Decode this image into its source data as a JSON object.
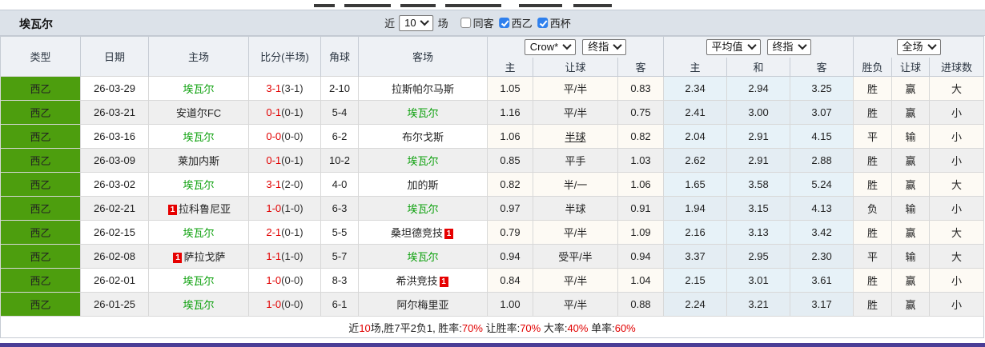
{
  "top_bar": {
    "team_name": "埃瓦尔",
    "recent": {
      "prefix": "近",
      "value": "10",
      "suffix": "场"
    },
    "filters": [
      {
        "label": "同客",
        "checked": false
      },
      {
        "label": "西乙",
        "checked": true
      },
      {
        "label": "西杯",
        "checked": true
      }
    ]
  },
  "controls": {
    "book_select": "Crow*",
    "book_time_select": "终指",
    "avg_select": "平均值",
    "avg_time_select": "终指",
    "scope_select": "全场"
  },
  "columns": {
    "type": "类型",
    "date": "日期",
    "home": "主场",
    "score": "比分(半场)",
    "corner": "角球",
    "away": "客场",
    "crow_home": "主",
    "crow_handicap": "让球",
    "crow_away": "客",
    "avg_home": "主",
    "avg_draw": "和",
    "avg_away": "客",
    "result_wdl": "胜负",
    "result_handicap": "让球",
    "result_goals": "进球数"
  },
  "accent_colors": {
    "league_green": "#4d9e0e",
    "self_team_green": "#0ca00c",
    "red": "#e10000",
    "blue": "#1414d6",
    "win_draw_green": "#009933",
    "avg_col_blue": "#e7f2f8",
    "bottom_bar_purple": "#4a3d96",
    "checkbox_blue": "#2f80ed"
  },
  "rows": [
    {
      "league": "西乙",
      "date": "26-03-29",
      "home": {
        "name": "埃瓦尔",
        "self": true,
        "badge": null,
        "badge_pos": null
      },
      "score": "3-1",
      "half": "(3-1)",
      "corner": "2-10",
      "away": {
        "name": "拉斯帕尔马斯",
        "self": false,
        "badge": null,
        "badge_pos": null
      },
      "odds": [
        "1.05",
        "平/半",
        "0.83"
      ],
      "handicap_hot": false,
      "avg": [
        "2.34",
        "2.94",
        "3.25"
      ],
      "results": [
        {
          "t": "胜",
          "c": "r"
        },
        {
          "t": "赢",
          "c": "r"
        },
        {
          "t": "大",
          "c": "r"
        }
      ]
    },
    {
      "league": "西乙",
      "date": "26-03-21",
      "home": {
        "name": "安道尔FC",
        "self": false,
        "badge": null,
        "badge_pos": null
      },
      "score": "0-1",
      "half": "(0-1)",
      "corner": "5-4",
      "away": {
        "name": "埃瓦尔",
        "self": true,
        "badge": null,
        "badge_pos": null
      },
      "odds": [
        "1.16",
        "平/半",
        "0.75"
      ],
      "handicap_hot": false,
      "avg": [
        "2.41",
        "3.00",
        "3.07"
      ],
      "results": [
        {
          "t": "胜",
          "c": "r"
        },
        {
          "t": "赢",
          "c": "r"
        },
        {
          "t": "小",
          "c": "b"
        }
      ]
    },
    {
      "league": "西乙",
      "date": "26-03-16",
      "home": {
        "name": "埃瓦尔",
        "self": true,
        "badge": null,
        "badge_pos": null
      },
      "score": "0-0",
      "half": "(0-0)",
      "corner": "6-2",
      "away": {
        "name": "布尔戈斯",
        "self": false,
        "badge": null,
        "badge_pos": null
      },
      "odds": [
        "1.06",
        "半球",
        "0.82"
      ],
      "handicap_hot": true,
      "avg": [
        "2.04",
        "2.91",
        "4.15"
      ],
      "results": [
        {
          "t": "平",
          "c": "g"
        },
        {
          "t": "输",
          "c": "b"
        },
        {
          "t": "小",
          "c": "b"
        }
      ]
    },
    {
      "league": "西乙",
      "date": "26-03-09",
      "home": {
        "name": "莱加内斯",
        "self": false,
        "badge": null,
        "badge_pos": null
      },
      "score": "0-1",
      "half": "(0-1)",
      "corner": "10-2",
      "away": {
        "name": "埃瓦尔",
        "self": true,
        "badge": null,
        "badge_pos": null
      },
      "odds": [
        "0.85",
        "平手",
        "1.03"
      ],
      "handicap_hot": false,
      "avg": [
        "2.62",
        "2.91",
        "2.88"
      ],
      "results": [
        {
          "t": "胜",
          "c": "r"
        },
        {
          "t": "赢",
          "c": "r"
        },
        {
          "t": "小",
          "c": "b"
        }
      ]
    },
    {
      "league": "西乙",
      "date": "26-03-02",
      "home": {
        "name": "埃瓦尔",
        "self": true,
        "badge": null,
        "badge_pos": null
      },
      "score": "3-1",
      "half": "(2-0)",
      "corner": "4-0",
      "away": {
        "name": "加的斯",
        "self": false,
        "badge": null,
        "badge_pos": null
      },
      "odds": [
        "0.82",
        "半/一",
        "1.06"
      ],
      "handicap_hot": false,
      "avg": [
        "1.65",
        "3.58",
        "5.24"
      ],
      "results": [
        {
          "t": "胜",
          "c": "r"
        },
        {
          "t": "赢",
          "c": "r"
        },
        {
          "t": "大",
          "c": "r"
        }
      ]
    },
    {
      "league": "西乙",
      "date": "26-02-21",
      "home": {
        "name": "拉科鲁尼亚",
        "self": false,
        "badge": "1",
        "badge_pos": "before"
      },
      "score": "1-0",
      "half": "(1-0)",
      "corner": "6-3",
      "away": {
        "name": "埃瓦尔",
        "self": true,
        "badge": null,
        "badge_pos": null
      },
      "odds": [
        "0.97",
        "半球",
        "0.91"
      ],
      "handicap_hot": false,
      "avg": [
        "1.94",
        "3.15",
        "4.13"
      ],
      "results": [
        {
          "t": "负",
          "c": "b"
        },
        {
          "t": "输",
          "c": "b"
        },
        {
          "t": "小",
          "c": "b"
        }
      ]
    },
    {
      "league": "西乙",
      "date": "26-02-15",
      "home": {
        "name": "埃瓦尔",
        "self": true,
        "badge": null,
        "badge_pos": null
      },
      "score": "2-1",
      "half": "(0-1)",
      "corner": "5-5",
      "away": {
        "name": "桑坦德竞技",
        "self": false,
        "badge": "1",
        "badge_pos": "after"
      },
      "odds": [
        "0.79",
        "平/半",
        "1.09"
      ],
      "handicap_hot": false,
      "avg": [
        "2.16",
        "3.13",
        "3.42"
      ],
      "results": [
        {
          "t": "胜",
          "c": "r"
        },
        {
          "t": "赢",
          "c": "r"
        },
        {
          "t": "大",
          "c": "r"
        }
      ]
    },
    {
      "league": "西乙",
      "date": "26-02-08",
      "home": {
        "name": "萨拉戈萨",
        "self": false,
        "badge": "1",
        "badge_pos": "before"
      },
      "score": "1-1",
      "half": "(1-0)",
      "corner": "5-7",
      "away": {
        "name": "埃瓦尔",
        "self": true,
        "badge": null,
        "badge_pos": null
      },
      "odds": [
        "0.94",
        "受平/半",
        "0.94"
      ],
      "handicap_hot": false,
      "avg": [
        "3.37",
        "2.95",
        "2.30"
      ],
      "results": [
        {
          "t": "平",
          "c": "g"
        },
        {
          "t": "输",
          "c": "b"
        },
        {
          "t": "大",
          "c": "r"
        }
      ]
    },
    {
      "league": "西乙",
      "date": "26-02-01",
      "home": {
        "name": "埃瓦尔",
        "self": true,
        "badge": null,
        "badge_pos": null
      },
      "score": "1-0",
      "half": "(0-0)",
      "corner": "8-3",
      "away": {
        "name": "希洪竞技",
        "self": false,
        "badge": "1",
        "badge_pos": "after"
      },
      "odds": [
        "0.84",
        "平/半",
        "1.04"
      ],
      "handicap_hot": false,
      "avg": [
        "2.15",
        "3.01",
        "3.61"
      ],
      "results": [
        {
          "t": "胜",
          "c": "r"
        },
        {
          "t": "赢",
          "c": "r"
        },
        {
          "t": "小",
          "c": "b"
        }
      ]
    },
    {
      "league": "西乙",
      "date": "26-01-25",
      "home": {
        "name": "埃瓦尔",
        "self": true,
        "badge": null,
        "badge_pos": null
      },
      "score": "1-0",
      "half": "(0-0)",
      "corner": "6-1",
      "away": {
        "name": "阿尔梅里亚",
        "self": false,
        "badge": null,
        "badge_pos": null
      },
      "odds": [
        "1.00",
        "平/半",
        "0.88"
      ],
      "handicap_hot": false,
      "avg": [
        "2.24",
        "3.21",
        "3.17"
      ],
      "results": [
        {
          "t": "胜",
          "c": "r"
        },
        {
          "t": "赢",
          "c": "r"
        },
        {
          "t": "小",
          "c": "b"
        }
      ]
    }
  ],
  "footer": {
    "segments": [
      {
        "t": "近",
        "red": false
      },
      {
        "t": "10",
        "red": true
      },
      {
        "t": "场,胜7平2负1, 胜率:",
        "red": false
      },
      {
        "t": "70%",
        "red": true
      },
      {
        "t": " 让胜率:",
        "red": false
      },
      {
        "t": "70%",
        "red": true
      },
      {
        "t": " 大率:",
        "red": false
      },
      {
        "t": "40%",
        "red": true
      },
      {
        "t": " 单率:",
        "red": false
      },
      {
        "t": "60%",
        "red": true
      }
    ]
  }
}
